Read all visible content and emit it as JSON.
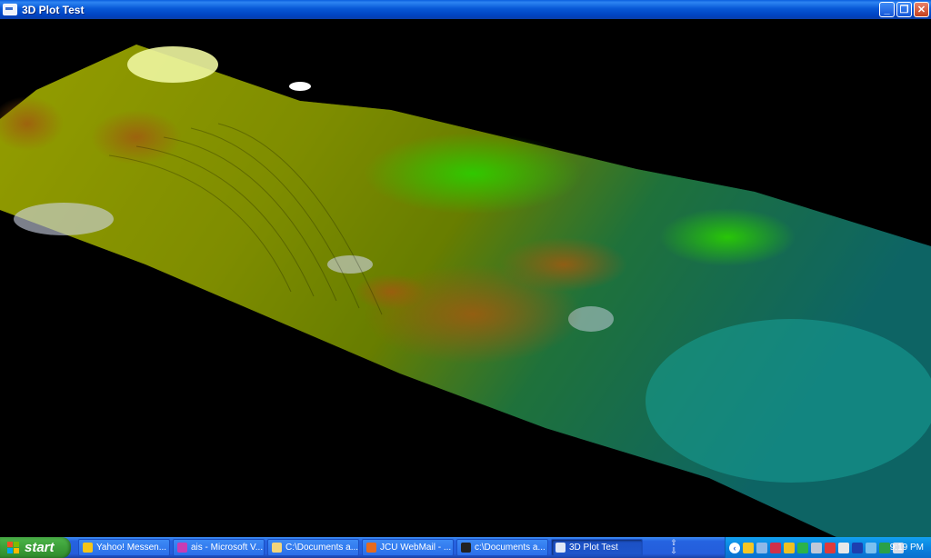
{
  "window": {
    "title": "3D Plot Test",
    "controls": {
      "minimize": "_",
      "maximize": "❐",
      "close": "✕"
    }
  },
  "taskbar": {
    "start_label": "start",
    "tasks": [
      {
        "label": "Yahoo! Messen...",
        "icon": "yahoo-messenger-icon",
        "color": "#f5c518",
        "active": false
      },
      {
        "label": "ais - Microsoft V...",
        "icon": "visual-studio-icon",
        "color": "#c83cb4",
        "active": false
      },
      {
        "label": "C:\\Documents a...",
        "icon": "folder-icon",
        "color": "#f3d57a",
        "active": false
      },
      {
        "label": "JCU WebMail - ...",
        "icon": "firefox-icon",
        "color": "#e66a1e",
        "active": false
      },
      {
        "label": "c:\\Documents a...",
        "icon": "console-icon",
        "color": "#222222",
        "active": false
      },
      {
        "label": "3D Plot Test",
        "icon": "app-window-icon",
        "color": "#dfe8f7",
        "active": true
      }
    ],
    "quick_launch_arrows": "⇧\n⇩",
    "tray_icons": [
      {
        "icon": "smiley-icon",
        "color": "#f6c623"
      },
      {
        "icon": "network-icon",
        "color": "#8fb8e8"
      },
      {
        "icon": "shield-icon",
        "color": "#d0304a"
      },
      {
        "icon": "yahoo-icon",
        "color": "#f0c020"
      },
      {
        "icon": "antivirus-icon",
        "color": "#2bb34a"
      },
      {
        "icon": "speaker-icon",
        "color": "#c0c8d8"
      },
      {
        "icon": "update-icon",
        "color": "#e03a3a"
      },
      {
        "icon": "printer-icon",
        "color": "#e8e8e8"
      },
      {
        "icon": "bluetooth-icon",
        "color": "#1d3fb0"
      },
      {
        "icon": "monitor-icon",
        "color": "#7ac0f0"
      },
      {
        "icon": "security-icon",
        "color": "#2aa048"
      },
      {
        "icon": "volume-icon",
        "color": "#d8dde8"
      }
    ],
    "clock": "9:19 PM"
  },
  "plot": {
    "background": "#000000",
    "colormap": [
      "#d8f000",
      "#b8e000",
      "#3cd000",
      "#20c080",
      "#18a0a0"
    ]
  }
}
